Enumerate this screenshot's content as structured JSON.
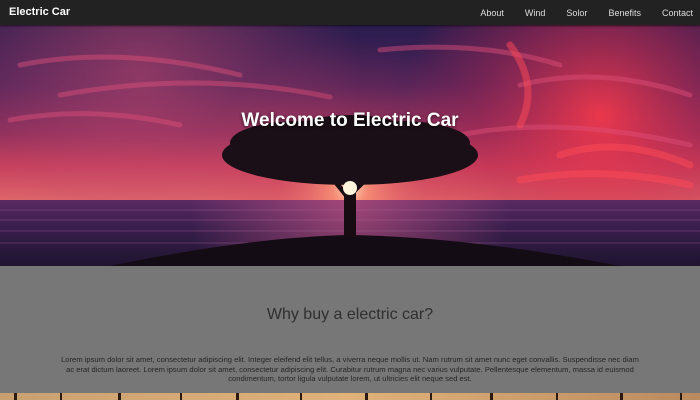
{
  "navbar": {
    "brand": "Electric Car",
    "links": [
      "About",
      "Wind",
      "Solor",
      "Benefits",
      "Contact"
    ]
  },
  "hero": {
    "title": "Welcome to Electric Car",
    "image": "sunset-tree-over-sea"
  },
  "section": {
    "title": "Why buy a electric car?",
    "body": "Lorem ipsum dolor sit amet, consectetur adipiscing elit. Integer eleifend elit tellus, a viverra neque mollis ut. Nam rutrum sit amet nunc eget convallis. Suspendisse nec diam ac erat dictum laoreet. Lorem ipsum dolor sit amet, consectetur adipiscing elit. Curabitur rutrum magna nec varius vulputate. Pellentesque elementum, massa id euismod condimentum, tortor ligula vulputate lorem, ut ultricies elit neque sed est."
  },
  "colors": {
    "navbar_bg": "#222222",
    "section_bg": "#777777",
    "sky_accent": "#e0305a"
  }
}
